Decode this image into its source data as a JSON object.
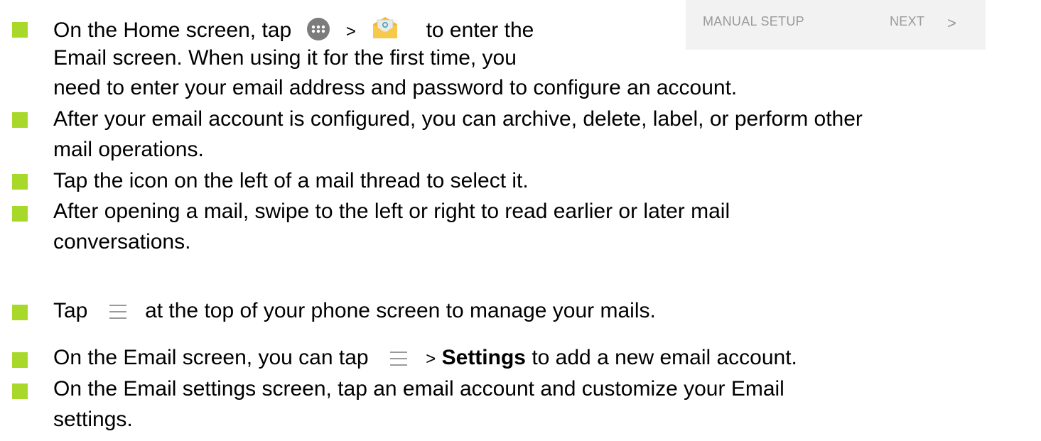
{
  "setup_bar": {
    "manual_label": "MANUAL SETUP",
    "next_label": "NEXT",
    "chevron": ">"
  },
  "icons": {
    "apps": "apps-grid-icon",
    "email_app": "email-app-icon",
    "menu": "menu-icon"
  },
  "colors": {
    "bullet": "#a8d92a",
    "panel_bg": "#f2f2f2",
    "panel_text": "#9a9a9a"
  },
  "items": [
    {
      "line1_a": "On the Home screen, tap",
      "line1_sep": ">",
      "line1_b": "to enter the",
      "line2": "Email screen. When using it for the first time, you",
      "line3": "need to enter your email address and password to configure an account."
    },
    {
      "line1": "After your email account is configured, you can archive, delete, label, or perform other",
      "line2": "mail operations."
    },
    {
      "line1": "Tap the icon on the left of a mail thread to select it."
    },
    {
      "line1": "After opening a mail, swipe to the left or right to read earlier or later mail",
      "line2": "conversations."
    },
    {
      "line1_a": "Tap",
      "line1_b": "at the top of your phone screen to manage your mails."
    },
    {
      "line1_a": "On the Email screen, you can tap",
      "line1_sep": ">",
      "line1_bold": "Settings",
      "line1_b": "to add a new email account."
    },
    {
      "line1": "On the Email settings screen, tap an email account and customize your Email",
      "line2": "settings."
    }
  ]
}
